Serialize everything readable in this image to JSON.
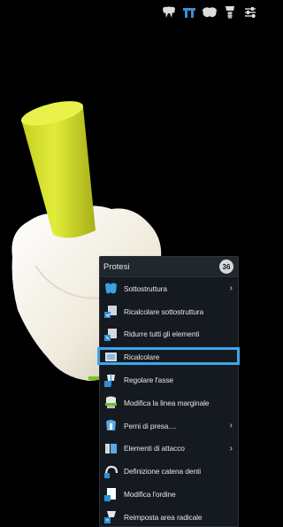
{
  "toolbar": {
    "buttons": [
      {
        "icon": "teeth-icon"
      },
      {
        "icon": "bridge-icon"
      },
      {
        "icon": "jaw-icon"
      },
      {
        "icon": "implant-icon"
      },
      {
        "icon": "sliders-icon"
      }
    ]
  },
  "viewport": {
    "description_icon": "3d-tooth-model"
  },
  "menu": {
    "title": "Protesi",
    "badge": "36",
    "items": [
      {
        "label": "Sottostruttura",
        "icon": "substructure-icon",
        "submenu": true
      },
      {
        "label": "Ricalcolare sottostruttura",
        "icon": "recalc-substructure-icon",
        "submenu": false
      },
      {
        "label": "Ridurre tutti gli elementi",
        "icon": "reduce-elements-icon",
        "submenu": false
      },
      {
        "label": "Ricalcolare",
        "icon": "recalculate-icon",
        "submenu": false,
        "highlighted": true
      },
      {
        "label": "Regolare l'asse",
        "icon": "adjust-axis-icon",
        "submenu": false
      },
      {
        "label": "Modifica la linea marginale",
        "icon": "margin-line-icon",
        "submenu": false
      },
      {
        "label": "Perni di presa....",
        "icon": "grip-pins-icon",
        "submenu": true
      },
      {
        "label": "Elementi di attacco",
        "icon": "attachment-elements-icon",
        "submenu": true
      },
      {
        "label": "Definizione catena denti",
        "icon": "tooth-chain-icon",
        "submenu": false
      },
      {
        "label": "Modifica l'ordine",
        "icon": "modify-order-icon",
        "submenu": false
      },
      {
        "label": "Reimposta area radicale",
        "icon": "reset-root-area-icon",
        "submenu": false
      }
    ],
    "submenu_arrow": "›"
  },
  "colors": {
    "highlight": "#3fa6ea",
    "menu_bg": "#141a1f",
    "tooth": "#f4f1e6",
    "abutment": "#d6e02e",
    "accent": "#2f8fd6"
  }
}
